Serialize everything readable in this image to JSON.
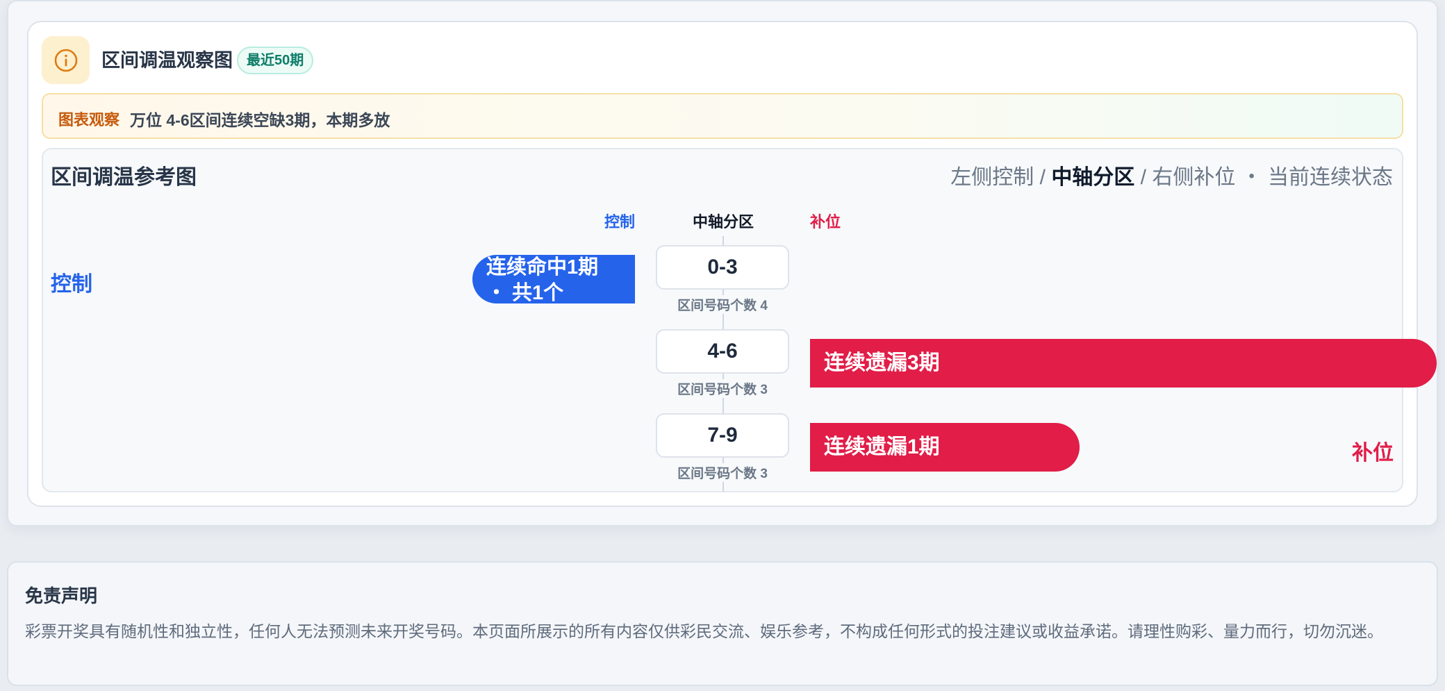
{
  "header": {
    "title": "区间调温观察图",
    "badge": "最近50期",
    "icon": "info-icon"
  },
  "observation": {
    "tag": "图表观察",
    "text": "万位 4-6区间连续空缺3期，本期多放"
  },
  "panel": {
    "title": "区间调温参考图",
    "legend_left": "左侧控制 / ",
    "legend_mid": "中轴分区",
    "legend_right": " / 右侧补位 ・ 当前连续状态"
  },
  "columns": {
    "control": "控制",
    "axis": "中轴分区",
    "fill": "补位"
  },
  "rows": [
    {
      "range": "0-3",
      "count_label": "区间号码个数 4",
      "side": "控制",
      "bar_line1": "连续命中1期",
      "bar_line2": "・ 共1个",
      "streak": 1
    },
    {
      "range": "4-6",
      "count_label": "区间号码个数 3",
      "side": "补位",
      "bar_text": "连续遗漏3期",
      "streak": 3
    },
    {
      "range": "7-9",
      "count_label": "区间号码个数 3",
      "side": "补位",
      "bar_text": "连续遗漏1期",
      "streak": 1
    }
  ],
  "disclaimer": {
    "title": "免责声明",
    "text": "彩票开奖具有随机性和独立性，任何人无法预测未来开奖号码。本页面所展示的所有内容仅供彩民交流、娱乐参考，不构成任何形式的投注建议或收益承诺。请理性购彩、量力而行，切勿沉迷。"
  },
  "colors": {
    "control": "#2563eb",
    "fill": "#e11d48",
    "accent_badge": "#0d7d68",
    "observe_tag": "#c65a0c"
  }
}
